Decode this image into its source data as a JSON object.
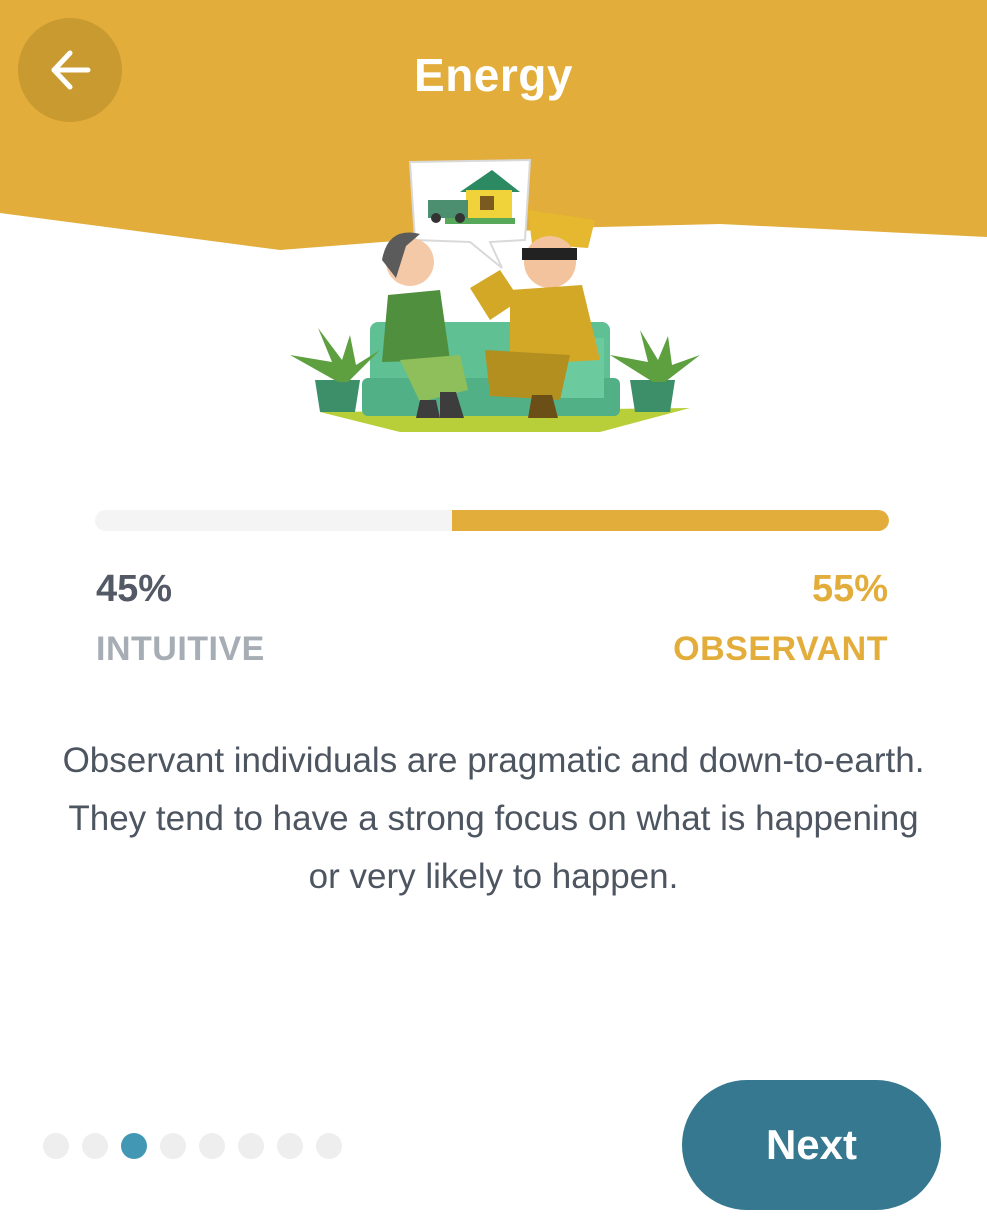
{
  "header": {
    "title": "Energy",
    "back_icon": "arrow-left-icon"
  },
  "trait_bar": {
    "left": {
      "percent": "45%",
      "label": "INTUITIVE",
      "value": 45
    },
    "right": {
      "percent": "55%",
      "label": "OBSERVANT",
      "value": 55
    }
  },
  "description": "Observant individuals are pragmatic and down-to-earth. They tend to have a strong focus on what is happening or very likely to happen.",
  "pager": {
    "total": 8,
    "active_index": 2
  },
  "next_button": {
    "label": "Next"
  },
  "colors": {
    "header": "#e2ad3a",
    "accent": "#e2ad3a",
    "button": "#357890",
    "active_dot": "#4298b4",
    "text": "#4d5561"
  }
}
